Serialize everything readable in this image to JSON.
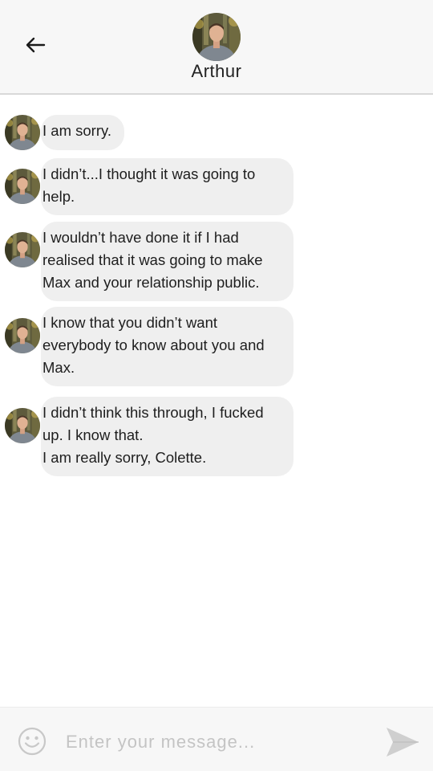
{
  "header": {
    "contact_name": "Arthur"
  },
  "messages": [
    {
      "text": "I am sorry."
    },
    {
      "text": "I didn’t...I thought it was going to\nhelp."
    },
    {
      "text": "I wouldn’t have done it if I had\nrealised that it was going to make\nMax and your relationship public."
    },
    {
      "text": "I know that you didn’t want\neverybody to know about you and\nMax."
    },
    {
      "text": "I didn’t think this through, I fucked\nup. I know that.\nI am really sorry, Colette."
    }
  ],
  "composer": {
    "placeholder": "Enter your message..."
  },
  "icons": {
    "back": "arrow-left-icon",
    "emoji": "smiley-icon",
    "send": "send-icon"
  },
  "colors": {
    "header_bg": "#f7f7f7",
    "bubble_bg": "#efefef",
    "icon_gray": "#c8c8c8"
  }
}
